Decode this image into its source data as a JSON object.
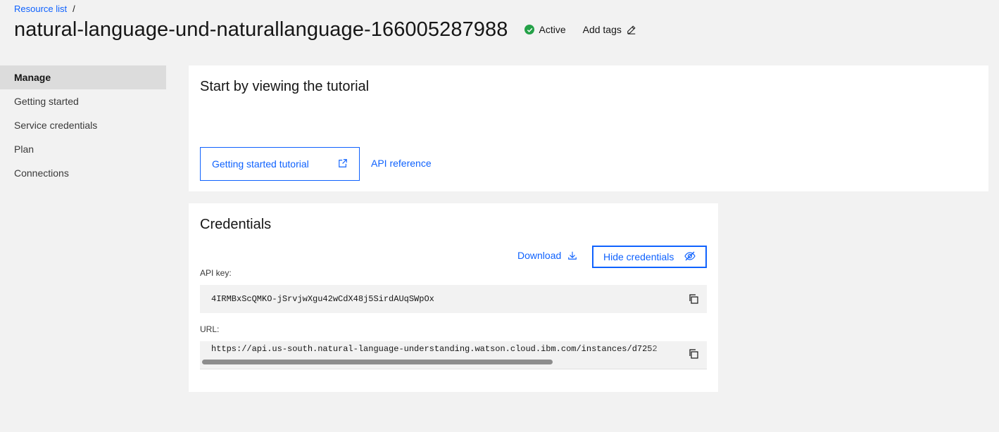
{
  "breadcrumb": {
    "link": "Resource list",
    "separator": "/"
  },
  "header": {
    "title": "natural-language-und-naturallanguage-166005287988",
    "status": "Active",
    "status_color": "#24a148",
    "add_tags": "Add tags"
  },
  "sidebar": {
    "items": [
      {
        "label": "Manage",
        "active": true
      },
      {
        "label": "Getting started"
      },
      {
        "label": "Service credentials"
      },
      {
        "label": "Plan"
      },
      {
        "label": "Connections"
      }
    ]
  },
  "tutorial": {
    "title": "Start by viewing the tutorial",
    "button_label": "Getting started tutorial",
    "api_link": "API reference"
  },
  "credentials": {
    "title": "Credentials",
    "download_label": "Download",
    "hide_label": "Hide credentials",
    "api_key_label": "API key:",
    "api_key_value": "4IRMBxScQMKO-jSrvjwXgu42wCdX48j5SirdAUqSWpOx",
    "url_label": "URL:",
    "url_value": "https://api.us-south.natural-language-understanding.watson.cloud.ibm.com/instances/d7252"
  },
  "colors": {
    "accent": "#0f62fe",
    "background": "#f2f2f2",
    "active_nav": "#dcdcdc"
  },
  "icons": [
    "checkmark-filled-icon",
    "edit-icon",
    "launch-icon",
    "download-icon",
    "view-off-icon",
    "copy-icon"
  ]
}
